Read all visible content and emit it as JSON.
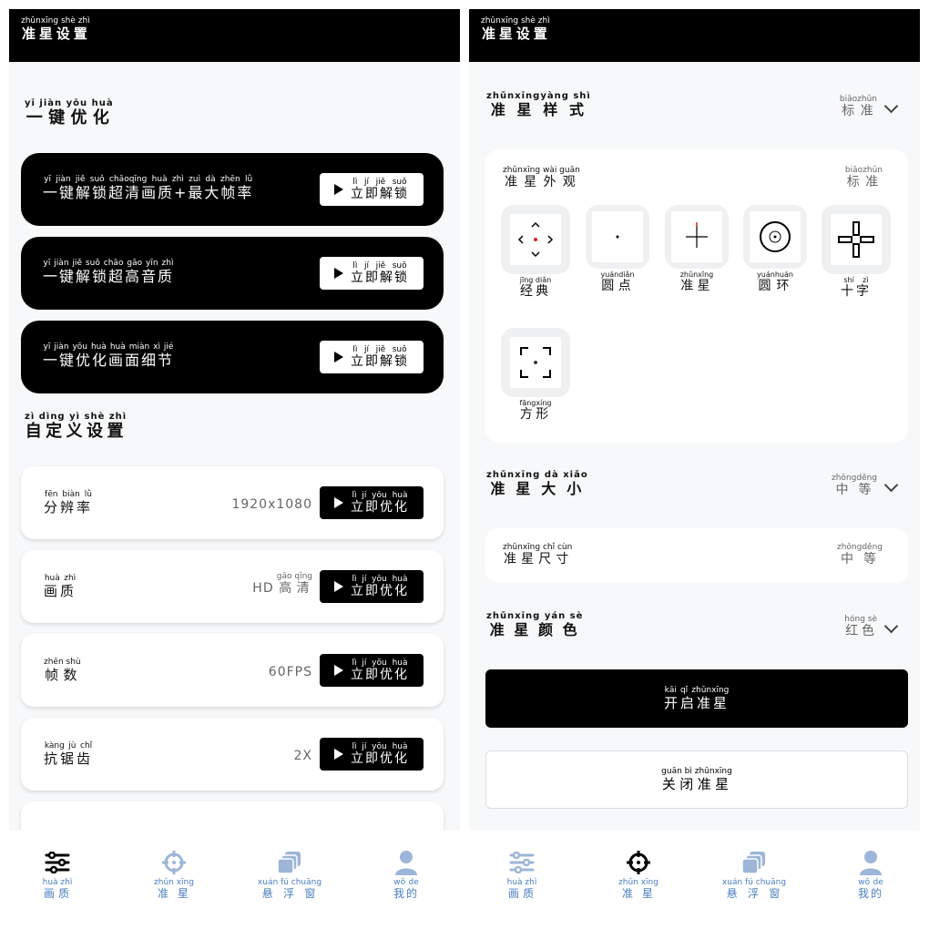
{
  "left": {
    "appbar_title": "准星设置",
    "appbar_title_py": "zhǔnxīng shè zhì",
    "quick_section": {
      "title": "一键优化",
      "py": "yī jiàn yōu huà"
    },
    "quick_cards": [
      {
        "label": "一键解锁超清画质+最大帧率",
        "py": "yī jiàn jiě suǒ chāoqīng huà zhì zuì dà zhēn lǜ",
        "button": "立即解锁",
        "button_py": "lì jí jiě suǒ"
      },
      {
        "label": "一键解锁超高音质",
        "py": "yī jiàn jiě suǒ chāo gāo yīn zhì",
        "button": "立即解锁",
        "button_py": "lì jí jiě suǒ"
      },
      {
        "label": "一键优化画面细节",
        "py": "yī jiàn yōu huà huà miàn xì jié",
        "button": "立即解锁",
        "button_py": "lì jí jiě suǒ"
      }
    ],
    "custom_section": {
      "title": "自定义设置",
      "py": "zì dìng yì shè zhì"
    },
    "custom_cards": [
      {
        "label": "分辨率",
        "py": "fēn biàn lǜ",
        "value": "1920x1080",
        "value_py": "",
        "button": "立即优化",
        "button_py": "lì jí yōu huà"
      },
      {
        "label": "画质",
        "py": "huà zhì",
        "value": "HD 高清",
        "value_py": "gāo qīng",
        "button": "立即优化",
        "button_py": "lì jí yōu huà"
      },
      {
        "label": "帧数",
        "py": "zhēn shù",
        "value": "60FPS",
        "value_py": "",
        "button": "立即优化",
        "button_py": "lì jí yōu huà"
      },
      {
        "label": "抗锯齿",
        "py": "kàng jù chǐ",
        "value": "2X",
        "value_py": "",
        "button": "立即优化",
        "button_py": "lì jí yōu huà"
      }
    ],
    "nav": [
      {
        "label": "画质",
        "py": "huà zhì",
        "icon": "sliders-icon",
        "active": true
      },
      {
        "label": "准星",
        "py": "zhǔn xīng",
        "icon": "crosshair-icon",
        "active": false
      },
      {
        "label": "悬浮窗",
        "py": "xuán fú chuāng",
        "icon": "windows-icon",
        "active": false
      },
      {
        "label": "我的",
        "py": "wǒ de",
        "icon": "person-icon",
        "active": false
      }
    ]
  },
  "right": {
    "appbar_title": "准星设置",
    "appbar_title_py": "zhǔnxīng shè zhì",
    "style_section": {
      "title": "准星样式",
      "py": "zhǔnxīngyàng shì",
      "value": "标准",
      "value_py": "biāozhǔn"
    },
    "appearance": {
      "label": "准星外观",
      "py": "zhǔnxīng wài guān",
      "value": "标准",
      "value_py": "biāozhǔn"
    },
    "styles": [
      {
        "name": "经典",
        "py": "jīng diǎn",
        "icon": "classic-crosshair-icon"
      },
      {
        "name": "圆点",
        "py": "yuándiǎn",
        "icon": "dot-crosshair-icon"
      },
      {
        "name": "准星",
        "py": "zhǔnxīng",
        "icon": "cross-crosshair-icon"
      },
      {
        "name": "圆环",
        "py": "yuánhuán",
        "icon": "ring-crosshair-icon"
      },
      {
        "name": "十字",
        "py": "shí zì",
        "icon": "thick-cross-icon"
      },
      {
        "name": "方形",
        "py": "fāngxíng",
        "icon": "square-crosshair-icon"
      }
    ],
    "size_section": {
      "title": "准星大小",
      "py": "zhǔnxīng dà xiǎo",
      "value": "中等",
      "value_py": "zhōngděng"
    },
    "size_row": {
      "label": "准星尺寸",
      "py": "zhǔnxīng chǐ cùn",
      "value": "中等",
      "value_py": "zhōngděng"
    },
    "color_section": {
      "title": "准星颜色",
      "py": "zhǔnxīng yán sè",
      "value": "红色",
      "value_py": "hóng sè"
    },
    "open_button": {
      "label": "开启准星",
      "py": "kāi qǐ zhǔnxīng"
    },
    "close_button": {
      "label": "关闭准星",
      "py": "guān bì zhǔnxīng"
    },
    "nav": [
      {
        "label": "画质",
        "py": "huà zhì",
        "icon": "sliders-icon",
        "active": false
      },
      {
        "label": "准星",
        "py": "zhǔn xīng",
        "icon": "crosshair-icon",
        "active": true
      },
      {
        "label": "悬浮窗",
        "py": "xuán fú chuāng",
        "icon": "windows-icon",
        "active": false
      },
      {
        "label": "我的",
        "py": "wǒ de",
        "icon": "person-icon",
        "active": false
      }
    ]
  },
  "colors": {
    "accent": "#4a7fc1",
    "inactive_icon": "#9db6d8",
    "black": "#000000",
    "background": "#f7f8fa",
    "crosshair_red": "#e02020"
  }
}
